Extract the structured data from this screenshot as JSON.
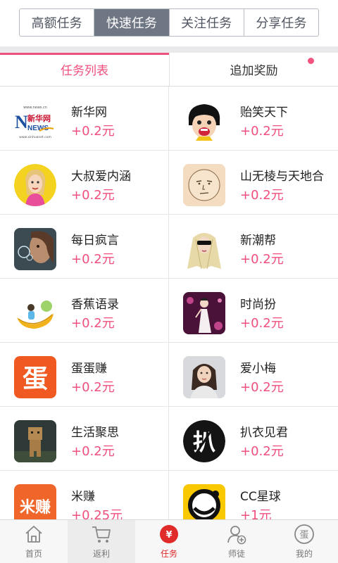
{
  "top_tabs": [
    {
      "label": "高额任务",
      "active": false
    },
    {
      "label": "快速任务",
      "active": true
    },
    {
      "label": "关注任务",
      "active": false
    },
    {
      "label": "分享任务",
      "active": false
    }
  ],
  "sub_tabs": {
    "list_label": "任务列表",
    "bonus_label": "追加奖励"
  },
  "tasks": [
    {
      "name": "新华网",
      "reward": "+0.2元",
      "icon": "xinhua-logo-icon",
      "logo_text": "新华网",
      "logo_sub": "NEWS"
    },
    {
      "name": "贻笑天下",
      "reward": "+0.2元",
      "icon": "cartoon-girl-icon"
    },
    {
      "name": "大叔爱内涵",
      "reward": "+0.2元",
      "icon": "cartoon-woman-icon"
    },
    {
      "name": "山无棱与天地合",
      "reward": "+0.2元",
      "icon": "sketch-face-icon"
    },
    {
      "name": "每日疯言",
      "reward": "+0.2元",
      "icon": "bubble-girl-photo-icon"
    },
    {
      "name": "新潮帮",
      "reward": "+0.2元",
      "icon": "sunglasses-blonde-icon"
    },
    {
      "name": "香蕉语录",
      "reward": "+0.2元",
      "icon": "banana-icon"
    },
    {
      "name": "时尚扮",
      "reward": "+0.2元",
      "icon": "fashion-illustration-icon"
    },
    {
      "name": "蛋蛋赚",
      "reward": "+0.2元",
      "icon": "dan-logo-icon",
      "logo_text": "蛋"
    },
    {
      "name": "爱小梅",
      "reward": "+0.2元",
      "icon": "woman-portrait-icon"
    },
    {
      "name": "生活聚思",
      "reward": "+0.2元",
      "icon": "cardboard-robot-icon"
    },
    {
      "name": "扒衣见君",
      "reward": "+0.2元",
      "icon": "ba-logo-icon",
      "logo_text": "扒"
    },
    {
      "name": "米赚",
      "reward": "+0.25元",
      "icon": "mizhuan-logo-icon",
      "logo_text": "米赚"
    },
    {
      "name": "CC星球",
      "reward": "+1元",
      "icon": "cc-planet-icon"
    }
  ],
  "bottom_nav": [
    {
      "label": "首页",
      "icon": "home-icon",
      "active": false
    },
    {
      "label": "返利",
      "icon": "cart-icon",
      "active": false
    },
    {
      "label": "任务",
      "icon": "yen-coin-icon",
      "active": true,
      "glyph": "¥"
    },
    {
      "label": "师徒",
      "icon": "add-user-icon",
      "active": false
    },
    {
      "label": "我的",
      "icon": "egg-profile-icon",
      "active": false,
      "glyph": "蛋"
    }
  ],
  "colors": {
    "accent_pink": "#ef4f7d",
    "active_segment": "#707784",
    "nav_active_red": "#e12a2a"
  }
}
